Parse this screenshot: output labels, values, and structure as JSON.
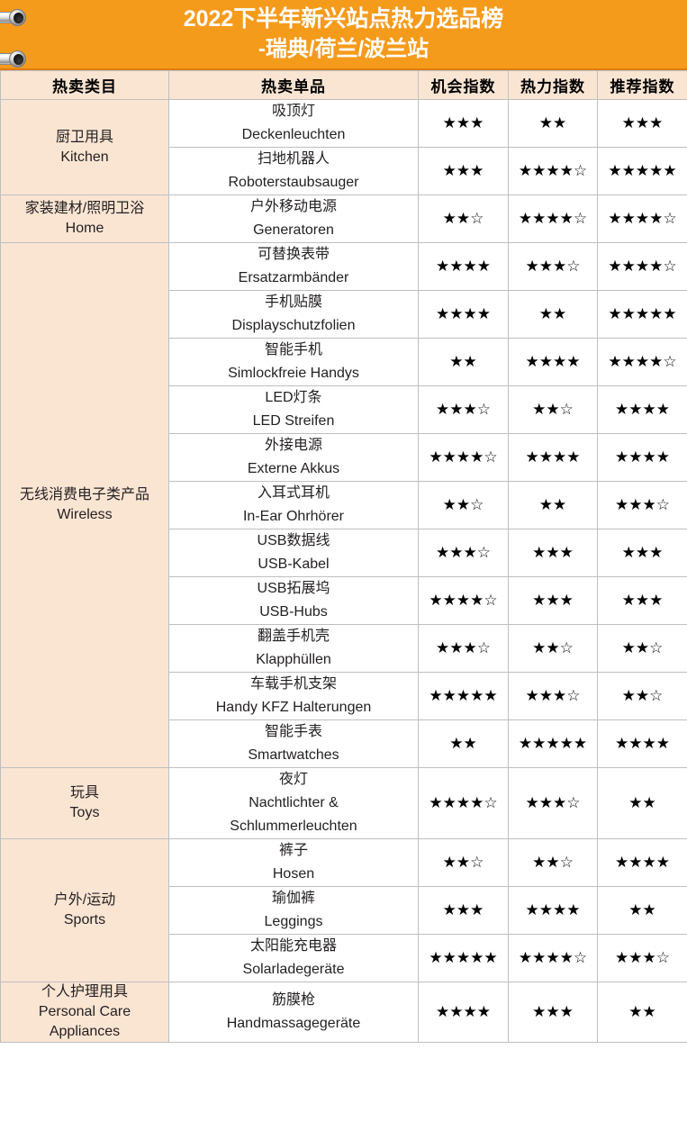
{
  "banner": {
    "title_line1": "2022下半年新兴站点热力选品榜",
    "title_line2": "-瑞典/荷兰/波兰站",
    "background_color": "#F59B1C",
    "text_color": "#FFFFFF"
  },
  "decor": {
    "ring_top": "binder-ring",
    "ring_bottom": "binder-ring"
  },
  "table": {
    "header_background": "#FAE5D3",
    "category_background": "#FAE5D3",
    "border_color": "#BFBFBF",
    "columns": [
      {
        "key": "category",
        "label": "热卖类目"
      },
      {
        "key": "item",
        "label": "热卖单品"
      },
      {
        "key": "opportunity",
        "label": "机会指数"
      },
      {
        "key": "heat",
        "label": "热力指数"
      },
      {
        "key": "recommend",
        "label": "推荐指数"
      }
    ],
    "groups": [
      {
        "category_cn": "厨卫用具",
        "category_en": "Kitchen",
        "rows": [
          {
            "item_cn": "吸顶灯",
            "item_en": "Deckenleuchten",
            "opportunity": {
              "full": 3,
              "half": 0
            },
            "heat": {
              "full": 2,
              "half": 0
            },
            "recommend": {
              "full": 3,
              "half": 0
            }
          },
          {
            "item_cn": "扫地机器人",
            "item_en": "Roboterstaubsauger",
            "opportunity": {
              "full": 3,
              "half": 0
            },
            "heat": {
              "full": 4,
              "half": 1
            },
            "recommend": {
              "full": 5,
              "half": 0
            }
          }
        ]
      },
      {
        "category_cn": "家装建材/照明卫浴",
        "category_en": "Home",
        "rows": [
          {
            "item_cn": "户外移动电源",
            "item_en": "Generatoren",
            "opportunity": {
              "full": 2,
              "half": 1
            },
            "heat": {
              "full": 4,
              "half": 1
            },
            "recommend": {
              "full": 4,
              "half": 1
            }
          }
        ]
      },
      {
        "category_cn": "无线消费电子类产品",
        "category_en": "Wireless",
        "rows": [
          {
            "item_cn": "可替换表带",
            "item_en": "Ersatzarmbänder",
            "opportunity": {
              "full": 4,
              "half": 0
            },
            "heat": {
              "full": 3,
              "half": 1
            },
            "recommend": {
              "full": 4,
              "half": 1
            }
          },
          {
            "item_cn": "手机贴膜",
            "item_en": "Displayschutzfolien",
            "opportunity": {
              "full": 4,
              "half": 0
            },
            "heat": {
              "full": 2,
              "half": 0
            },
            "recommend": {
              "full": 5,
              "half": 0
            }
          },
          {
            "item_cn": "智能手机",
            "item_en": "Simlockfreie Handys",
            "opportunity": {
              "full": 2,
              "half": 0
            },
            "heat": {
              "full": 4,
              "half": 0
            },
            "recommend": {
              "full": 4,
              "half": 1
            }
          },
          {
            "item_cn": "LED灯条",
            "item_en": "LED Streifen",
            "opportunity": {
              "full": 3,
              "half": 1
            },
            "heat": {
              "full": 2,
              "half": 1
            },
            "recommend": {
              "full": 4,
              "half": 0
            }
          },
          {
            "item_cn": "外接电源",
            "item_en": "Externe Akkus",
            "opportunity": {
              "full": 4,
              "half": 1
            },
            "heat": {
              "full": 4,
              "half": 0
            },
            "recommend": {
              "full": 4,
              "half": 0
            }
          },
          {
            "item_cn": "入耳式耳机",
            "item_en": "In-Ear Ohrhörer",
            "opportunity": {
              "full": 2,
              "half": 1
            },
            "heat": {
              "full": 2,
              "half": 0
            },
            "recommend": {
              "full": 3,
              "half": 1
            }
          },
          {
            "item_cn": "USB数据线",
            "item_en": "USB-Kabel",
            "opportunity": {
              "full": 3,
              "half": 1
            },
            "heat": {
              "full": 3,
              "half": 0
            },
            "recommend": {
              "full": 3,
              "half": 0
            }
          },
          {
            "item_cn": "USB拓展坞",
            "item_en": "USB-Hubs",
            "opportunity": {
              "full": 4,
              "half": 1
            },
            "heat": {
              "full": 3,
              "half": 0
            },
            "recommend": {
              "full": 3,
              "half": 0
            }
          },
          {
            "item_cn": "翻盖手机壳",
            "item_en": "Klapphüllen",
            "opportunity": {
              "full": 3,
              "half": 1
            },
            "heat": {
              "full": 2,
              "half": 1
            },
            "recommend": {
              "full": 2,
              "half": 1
            }
          },
          {
            "item_cn": "车载手机支架",
            "item_en": "Handy KFZ Halterungen",
            "opportunity": {
              "full": 5,
              "half": 0
            },
            "heat": {
              "full": 3,
              "half": 1
            },
            "recommend": {
              "full": 2,
              "half": 1
            }
          },
          {
            "item_cn": "智能手表",
            "item_en": "Smartwatches",
            "opportunity": {
              "full": 2,
              "half": 0
            },
            "heat": {
              "full": 5,
              "half": 0
            },
            "recommend": {
              "full": 4,
              "half": 0
            }
          }
        ]
      },
      {
        "category_cn": "玩具",
        "category_en": "Toys",
        "rows": [
          {
            "item_cn": "夜灯",
            "item_en": "Nachtlichter &\nSchlummerleuchten",
            "opportunity": {
              "full": 4,
              "half": 1
            },
            "heat": {
              "full": 3,
              "half": 1
            },
            "recommend": {
              "full": 2,
              "half": 0
            }
          }
        ]
      },
      {
        "category_cn": "户外/运动",
        "category_en": "Sports",
        "rows": [
          {
            "item_cn": "裤子",
            "item_en": "Hosen",
            "opportunity": {
              "full": 2,
              "half": 1
            },
            "heat": {
              "full": 2,
              "half": 1
            },
            "recommend": {
              "full": 4,
              "half": 0
            }
          },
          {
            "item_cn": "瑜伽裤",
            "item_en": "Leggings",
            "opportunity": {
              "full": 3,
              "half": 0
            },
            "heat": {
              "full": 4,
              "half": 0
            },
            "recommend": {
              "full": 2,
              "half": 0
            }
          },
          {
            "item_cn": "太阳能充电器",
            "item_en": "Solarladegeräte",
            "opportunity": {
              "full": 5,
              "half": 0
            },
            "heat": {
              "full": 4,
              "half": 1
            },
            "recommend": {
              "full": 3,
              "half": 1
            }
          }
        ]
      },
      {
        "category_cn": "个人护理用具",
        "category_en": "Personal Care\nAppliances",
        "rows": [
          {
            "item_cn": "筋膜枪",
            "item_en": "Handmassagegeräte",
            "opportunity": {
              "full": 4,
              "half": 0
            },
            "heat": {
              "full": 3,
              "half": 0
            },
            "recommend": {
              "full": 2,
              "half": 0
            }
          }
        ]
      }
    ]
  },
  "glyphs": {
    "star_full": "★",
    "star_hollow": "☆"
  }
}
